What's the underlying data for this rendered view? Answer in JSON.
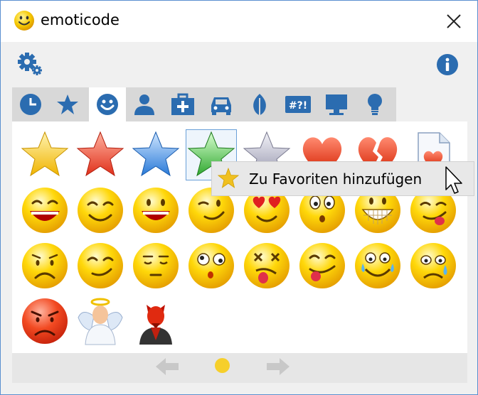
{
  "window": {
    "title": "emoticode"
  },
  "icons": {
    "app": "smiley-icon",
    "close": "close-icon",
    "settings": "gear-icon",
    "info": "info-icon"
  },
  "tabs": [
    {
      "name": "recent",
      "icon": "clock-icon",
      "active": false
    },
    {
      "name": "favorites",
      "icon": "star-icon",
      "active": false
    },
    {
      "name": "smileys",
      "icon": "smiley-icon",
      "active": true
    },
    {
      "name": "people",
      "icon": "person-icon",
      "active": false
    },
    {
      "name": "objects",
      "icon": "medical-bag-icon",
      "active": false
    },
    {
      "name": "travel",
      "icon": "car-icon",
      "active": false
    },
    {
      "name": "nature",
      "icon": "leaf-icon",
      "active": false
    },
    {
      "name": "symbols",
      "icon": "symbols-icon",
      "label": "#?!",
      "active": false
    },
    {
      "name": "computer",
      "icon": "monitor-icon",
      "active": false
    },
    {
      "name": "ideas",
      "icon": "lightbulb-icon",
      "active": false
    }
  ],
  "emojis": [
    "yellow-star",
    "red-star",
    "blue-star",
    "green-star",
    "silver-star",
    "red-heart",
    "broken-heart",
    "heart-document",
    "laughing-face",
    "smiling-face",
    "grinning-face",
    "winking-face",
    "heart-eyes-face",
    "surprised-face",
    "big-grin-face",
    "tongue-face",
    "sad-face",
    "smirking-face",
    "sleepy-face",
    "confused-face",
    "dizzy-face",
    "silly-face",
    "tears-of-joy-face",
    "crying-face",
    "angry-face",
    "angel",
    "devil"
  ],
  "hovered_emoji": "green-star",
  "tooltip": {
    "text": "Zu Favoriten hinzufügen",
    "icon": "star-icon"
  },
  "pagination": {
    "pages": 1,
    "current": 1
  },
  "colors": {
    "accent": "#2b6cb0",
    "active_tab": "#ffffff",
    "tab_bar": "#d8d8d8",
    "dot": "#f6cf2b"
  }
}
